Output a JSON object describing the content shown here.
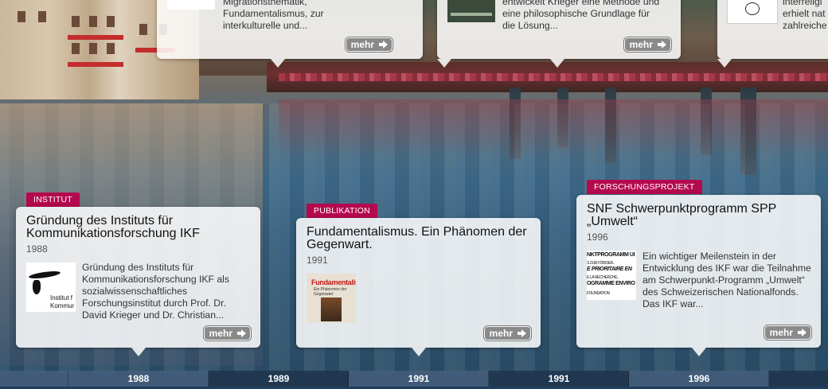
{
  "top_cards": [
    {
      "desc_lines": [
        "Migrationsthematik,",
        "Fundamentalismus, zur",
        "interkulturelle und..."
      ],
      "button": "mehr"
    },
    {
      "desc_lines": [
        "entwickelt Krieger eine Methode und",
        "eine philosophische Grundlage für",
        "die Lösung..."
      ],
      "button": "mehr"
    },
    {
      "desc_lines": [
        "interreligi",
        "erhielt nat",
        "zahlreiche"
      ]
    }
  ],
  "cards": [
    {
      "tag": "INSTITUT",
      "title": "Gründung des Instituts für Kommunikationsforschung IKF",
      "year": "1988",
      "thumb_text": "Institut f Kommur",
      "description": "Gründung des Instituts für Kommunikationsforschung IKF als sozialwissenschaftliches Forschungsinstitut durch Prof. Dr. David Krieger und Dr. Christian...",
      "button": "mehr"
    },
    {
      "tag": "PUBLIKATION",
      "title": "Fundamentalismus. Ein Phänomen der Gegenwart.",
      "year": "1991",
      "thumb_title": "Fundamentalismus",
      "thumb_sub": "Ein Phänomen der Gegenwart",
      "button": "mehr"
    },
    {
      "tag": "FORSCHUNGSPROJEKT",
      "title": "SNF Schwerpunktprogramm SPP „Umwelt“",
      "year": "1996",
      "thumb_lines": [
        "NKTPROGRAMM UI",
        "S ZUR FÖRDER..",
        "E PRIORITAIRE EN",
        "E LA RECHERCHE..",
        "OGRAMME ENVIRO",
        "FOUNDATION"
      ],
      "description": "Ein wichtiger Meilenstein in der Entwicklung des IKF war die Teilnahme am Schwerpunkt-Programm „Umwelt“ des Schweizerischen Nationalfonds. Das IKF war...",
      "button": "mehr"
    }
  ],
  "timeline": {
    "labels": [
      "1988",
      "1989",
      "1991",
      "1991",
      "1996"
    ]
  },
  "colors": {
    "tag": "#b4094e",
    "button": "#8a8a8a",
    "timeline": "#1e3e5e"
  }
}
